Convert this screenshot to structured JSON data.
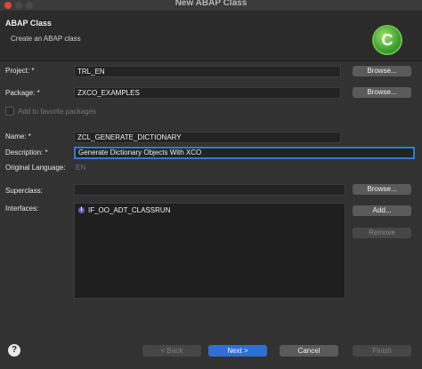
{
  "window": {
    "title": "New ABAP Class"
  },
  "header": {
    "title": "ABAP Class",
    "description": "Create an ABAP class",
    "icon": "abap-class-icon"
  },
  "form": {
    "project_label": "Project: *",
    "project_value": "TRL_EN",
    "package_label": "Package: *",
    "package_value": "ZXCO_EXAMPLES",
    "favorite_label": "Add to favorite packages",
    "name_label": "Name: *",
    "name_value": "ZCL_GENERATE_DICTIONARY",
    "description_label": "Description: *",
    "description_value": "Generate Dictionary Objects With XCO",
    "original_language_label": "Original Language:",
    "original_language_value": "EN",
    "superclass_label": "Superclass:",
    "superclass_value": "",
    "interfaces_label": "Interfaces:",
    "interfaces": [
      {
        "name": "IF_OO_ADT_CLASSRUN",
        "icon": "interface-icon"
      }
    ]
  },
  "buttons": {
    "browse": "Browse...",
    "add": "Add...",
    "remove": "Remove",
    "back": "< Back",
    "next": "Next >",
    "cancel": "Cancel",
    "finish": "Finish",
    "help": "?"
  },
  "colors": {
    "background": "#323232",
    "focus_border": "#2f7ad6",
    "primary_button": "#2f6fd4"
  }
}
